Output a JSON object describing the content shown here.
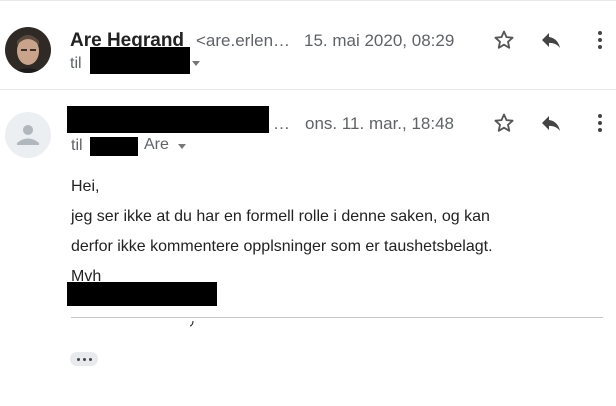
{
  "messages": [
    {
      "sender_name": "Are Hegrand",
      "sender_email": "<are.erlen…",
      "date": "15. mai 2020, 08:29",
      "to_label": "til",
      "avatar": "profile-photo",
      "icons": [
        "star-icon",
        "reply-icon",
        "more-vert-icon"
      ]
    },
    {
      "sender_ellipsis": "…",
      "date": "ons. 11. mar., 18:48",
      "to_label": "til",
      "to_name": "Are",
      "avatar": "default-person-icon",
      "icons": [
        "star-icon",
        "reply-icon",
        "more-vert-icon"
      ],
      "body": {
        "lines": [
          "Hei,",
          "jeg ser ikke at du har en formell rolle i denne saken, og kan",
          "derfor ikke kommentere opplsninger som er taushetsbelagt.",
          "Mvh"
        ]
      },
      "show_trimmed_icon": "ellipsis-icon"
    }
  ],
  "colors": {
    "secondary_text": "#5f6368",
    "primary_text": "#222222",
    "redaction": "#000000",
    "avatar_placeholder": "#eceff1"
  }
}
